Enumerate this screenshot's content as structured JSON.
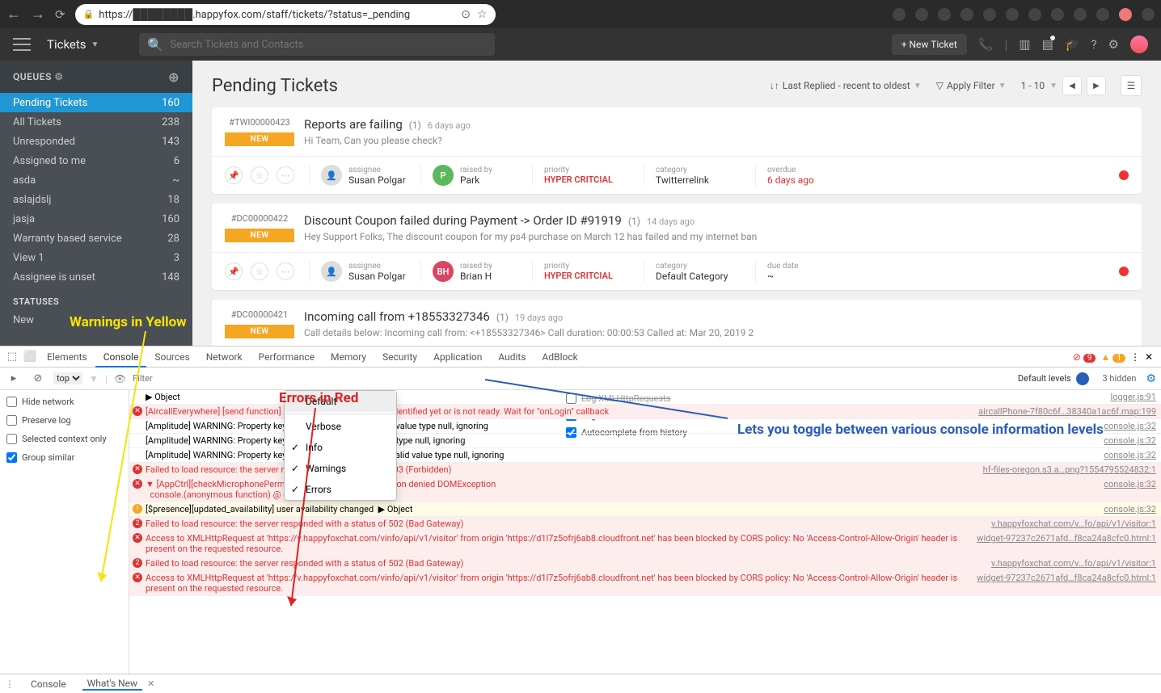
{
  "browser": {
    "url": "https://████████.happyfox.com/staff/tickets/?status=_pending"
  },
  "header": {
    "title": "Tickets",
    "search_placeholder": "Search Tickets and Contacts",
    "new_ticket": "+  New Ticket"
  },
  "sidebar": {
    "queues_label": "QUEUES",
    "items": [
      {
        "label": "Pending Tickets",
        "count": "160"
      },
      {
        "label": "All Tickets",
        "count": "238"
      },
      {
        "label": "Unresponded",
        "count": "143"
      },
      {
        "label": "Assigned to me",
        "count": "6"
      },
      {
        "label": "asda",
        "count": "~"
      },
      {
        "label": "aslajdslj",
        "count": "18"
      },
      {
        "label": "jasja",
        "count": "160"
      },
      {
        "label": "Warranty based service",
        "count": "28"
      },
      {
        "label": "View 1",
        "count": "3"
      },
      {
        "label": "Assignee is unset",
        "count": "148"
      }
    ],
    "statuses_label": "STATUSES",
    "status_items": [
      {
        "label": "New"
      }
    ]
  },
  "main": {
    "title": "Pending Tickets",
    "sort": "Last Replied - recent to oldest",
    "filter": "Apply Filter",
    "pager": "1 - 10"
  },
  "tickets": [
    {
      "id": "#TWI00000423",
      "badge": "NEW",
      "title": "Reports are failing",
      "count": "(1)",
      "age": "6 days ago",
      "preview": "Hi Team, Can you please check?",
      "assignee": "Susan Polgar",
      "raised_by": "Park",
      "raised_av": "P",
      "priority": "HYPER CRITCIAL",
      "category": "Twitterrelink",
      "overdue_label": "overdue",
      "overdue": "6 days ago"
    },
    {
      "id": "#DC00000422",
      "badge": "NEW",
      "title": "Discount Coupon failed during Payment -> Order ID #91919",
      "count": "(1)",
      "age": "14 days ago",
      "preview": "Hey Support Folks, The discount coupon for my ps4 purchase on March 12 has failed and my internet ban",
      "assignee": "Susan Polgar",
      "raised_by": "Brian H",
      "raised_av": "BH",
      "priority": "HYPER CRITCIAL",
      "category": "Default Category",
      "overdue_label": "due date",
      "overdue": "~"
    },
    {
      "id": "#DC00000421",
      "badge": "NEW",
      "title": "Incoming call from +18553327346",
      "count": "(1)",
      "age": "19 days ago",
      "preview": "Call details below: Incoming call from: <+18553327346> Call duration: 00:00:53 Called at: Mar 20, 2019 2",
      "assignee": "",
      "raised_by": "",
      "raised_av": "",
      "priority": "",
      "category": "",
      "overdue_label": "due date",
      "overdue": ""
    }
  ],
  "meta_labels": {
    "assignee": "assignee",
    "raised": "raised by",
    "priority": "priority",
    "category": "category"
  },
  "annotations": {
    "yellow": "Warnings in Yellow",
    "red": "Errors in Red",
    "blue": "Lets you toggle between various console information levels"
  },
  "devtools": {
    "tabs": [
      "Elements",
      "Console",
      "Sources",
      "Network",
      "Performance",
      "Memory",
      "Security",
      "Application",
      "Audits",
      "AdBlock"
    ],
    "active_tab": "Console",
    "err_count": "9",
    "warn_count": "1",
    "context": "top",
    "filter_placeholder": "Filter",
    "default_levels": "Default levels",
    "hidden": "3 hidden",
    "side_checks": [
      {
        "label": "Hide network",
        "checked": false
      },
      {
        "label": "Preserve log",
        "checked": false
      },
      {
        "label": "Selected context only",
        "checked": false
      },
      {
        "label": "Group similar",
        "checked": true
      }
    ],
    "right_checks": [
      {
        "label": "Log XMLHttpRequests",
        "checked": false,
        "struck": true
      },
      {
        "label": "Eager evaluation",
        "checked": true
      },
      {
        "label": "Autocomplete from history",
        "checked": true
      }
    ],
    "levels": [
      {
        "label": "Default",
        "checked": false
      },
      {
        "label": "Verbose",
        "checked": false
      },
      {
        "label": "Info",
        "checked": true
      },
      {
        "label": "Warnings",
        "checked": true
      },
      {
        "label": "Errors",
        "checked": true
      }
    ],
    "logs": [
      {
        "type": "obj",
        "msg": "▶ Object",
        "src": "logger.js:91"
      },
      {
        "type": "err",
        "msg": "[AircallEverywhere] [send function] Aircall Phone has not been identified yet or is not ready. Wait for \"onLogin\" callback",
        "src": "aircallPhone-7f80c6f…38340a1ac6f.map:199"
      },
      {
        "type": "log",
        "msg": "[Amplitude] WARNING: Property key \"billing_period\" with invalid value type null, ignoring",
        "src": "console.js:32"
      },
      {
        "type": "log",
        "msg": "[Amplitude] WARNING: Property key \"country\" with invalid value type null, ignoring",
        "src": "console.js:32"
      },
      {
        "type": "log",
        "msg": "[Amplitude] WARNING: Property key \"last_plan_change\" with invalid value type null, ignoring",
        "src": "console.js:32"
      },
      {
        "type": "err",
        "msg": "Failed to load resource: the server responded with a status of 403 (Forbidden)",
        "src": "hf-files-oregon.s3.a…png?1554795524832:1"
      },
      {
        "type": "err",
        "msg": "▼ [AppCtrl][checkMicrophonePermission] Microphone permission denied DOMException\n  console.(anonymous function) @ console.js:32",
        "src": "console.js:32"
      },
      {
        "type": "warn",
        "msg": "[$presence][updated_availability] user availability changed  ▶ Object",
        "src": "console.js:32"
      },
      {
        "type": "err2",
        "msg": "Failed to load resource: the server responded with a status of 502 (Bad Gateway)",
        "src": "v.happyfoxchat.com/v…fo/api/v1/visitor:1"
      },
      {
        "type": "err",
        "msg": "Access to XMLHttpRequest at 'https://v.happyfoxchat.com/vinfo/api/v1/visitor' from origin 'https://d1l7z5ofrj6ab8.cloudfront.net' has been blocked by CORS policy: No 'Access-Control-Allow-Origin' header is present on the requested resource.",
        "src": "widget-97237c2671afd…f8ca24a8cfc0.html:1"
      },
      {
        "type": "err2",
        "msg": "Failed to load resource: the server responded with a status of 502 (Bad Gateway)",
        "src": "v.happyfoxchat.com/v…fo/api/v1/visitor:1"
      },
      {
        "type": "err",
        "msg": "Access to XMLHttpRequest at 'https://v.happyfoxchat.com/vinfo/api/v1/visitor' from origin 'https://d1l7z5ofrj6ab8.cloudfront.net' has been blocked by CORS policy: No 'Access-Control-Allow-Origin' header is present on the requested resource.",
        "src": "widget-97237c2671afd…f8ca24a8cfc0.html:1"
      }
    ],
    "footer": {
      "console": "Console",
      "whatsnew": "What's New"
    }
  }
}
